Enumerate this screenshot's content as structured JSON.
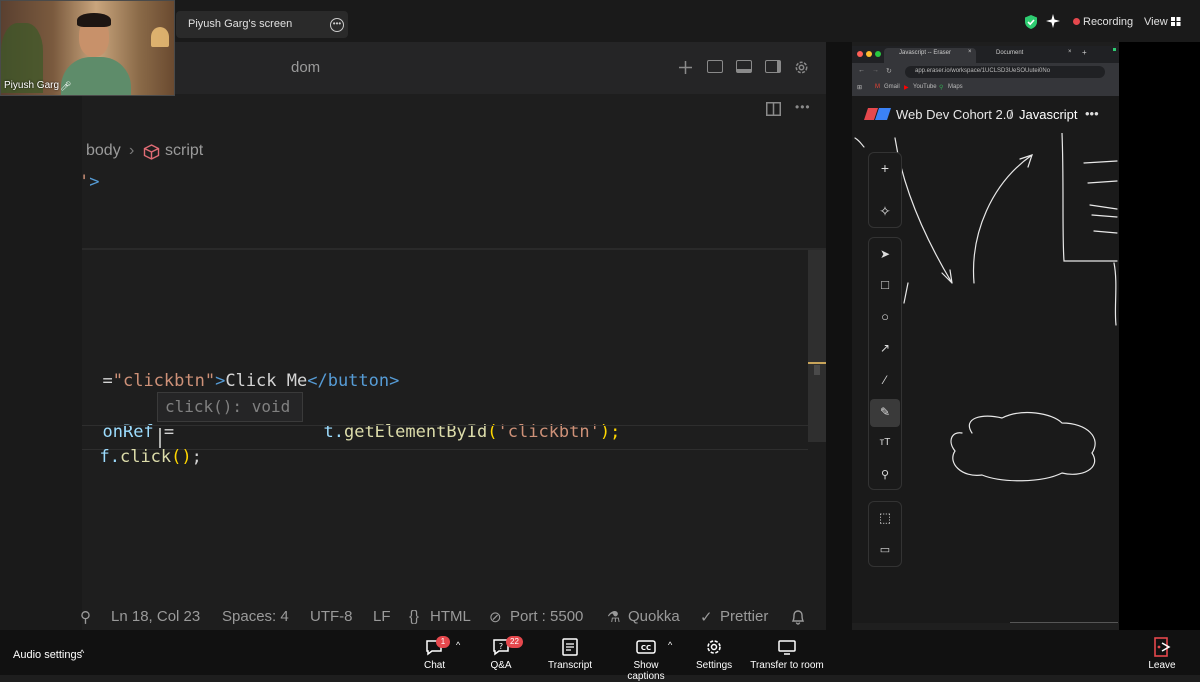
{
  "meeting": {
    "share_title": "Piyush Garg's screen",
    "recording_label": "Recording",
    "view_label": "View",
    "participant_name": "Piyush Garg"
  },
  "editor": {
    "title": "dom",
    "breadcrumb": [
      "body",
      "script"
    ],
    "code_top_fragment": "'>",
    "code": {
      "line_button_attr_tail": "=",
      "line_button_id": "\"clickbtn\"",
      "line_button_gt": ">",
      "line_button_text": "Click Me",
      "line_button_close": "</button>",
      "line_ref_var": "onRef",
      "line_ref_eq": " =",
      "line_ref_mid": "t.",
      "line_ref_fn": "getElementById",
      "line_ref_open": "(",
      "line_ref_arg": "'clickbtn'",
      "line_ref_close": ");",
      "line_click_var": "f.",
      "line_click_fn": "click",
      "line_click_paren_open": "(",
      "line_click_paren_close": ")",
      "line_click_semi": ";"
    },
    "hover_text": "click(): void",
    "status": {
      "position": "Ln 18, Col 23",
      "spaces": "Spaces: 4",
      "encoding": "UTF-8",
      "eol": "LF",
      "language": "HTML",
      "port": "Port : 5500",
      "quokka": "Quokka",
      "prettier": "Prettier"
    }
  },
  "browser": {
    "tabs": [
      "Javascript -- Eraser",
      "Document"
    ],
    "url": "app.eraser.io/workspace/1UCLSD3UeSOUutei0No",
    "bookmarks": [
      "Gmail",
      "YouTube",
      "Maps"
    ],
    "eraser": {
      "workspace": "Web Dev Cohort 2.0",
      "separator": "/",
      "page": "Javascript",
      "more": "•••"
    },
    "tools": [
      "plus",
      "ai-sparkle",
      "select",
      "rectangle",
      "circle",
      "arrow",
      "line",
      "pen",
      "text",
      "search",
      "frame",
      "comment"
    ]
  },
  "bottom_bar": {
    "audio_settings": "Audio settings",
    "chat": {
      "label": "Chat",
      "badge": "1"
    },
    "qa": {
      "label": "Q&A",
      "badge": "22"
    },
    "transcript": {
      "label": "Transcript"
    },
    "captions": {
      "label": "Show captions"
    },
    "settings": {
      "label": "Settings"
    },
    "transfer": {
      "label": "Transfer to room"
    },
    "leave": {
      "label": "Leave"
    }
  },
  "colors": {
    "recording": "#e5484d",
    "editor_bg": "#1e1e1e",
    "string": "#ce9178",
    "tag": "#569cd6",
    "function": "#dcdcaa",
    "variable": "#9cdcfe",
    "eraser_blue": "#3b82f6"
  }
}
